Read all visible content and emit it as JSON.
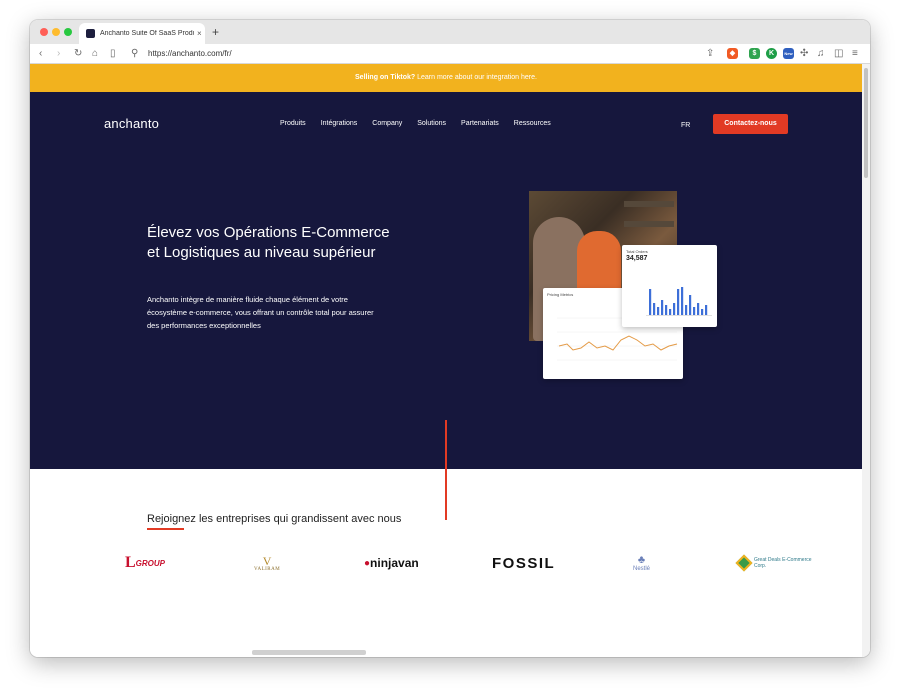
{
  "browser": {
    "tab_title": "Anchanto Suite Of SaaS Produ",
    "tab_close": "×",
    "new_tab": "+",
    "url": "https://anchanto.com/fr/",
    "ext_badge": "New"
  },
  "banner": {
    "bold": "Selling on Tiktok?",
    "text": " Learn more about our integration here."
  },
  "header": {
    "logo": "anchanto",
    "nav": [
      "Produits",
      "Intégrations",
      "Company",
      "Solutions",
      "Partenariats",
      "Ressources"
    ],
    "lang": "FR",
    "cta": "Contactez-nous"
  },
  "hero": {
    "title": "Élevez vos Opérations E-Commerce et Logistiques au niveau supérieur",
    "subtitle": "Anchanto intègre de manière fluide chaque élément de votre écosystème e-commerce, vous offrant un contrôle total pour assurer des performances exceptionnelles"
  },
  "dashboard": {
    "orders_label": "Total Orders",
    "orders_value": "34,587",
    "pricing_label": "Pricing Metrics"
  },
  "clients": {
    "title": "Rejoignez les entreprises qui grandissent avec nous",
    "logos": [
      "GROUP",
      "VALIRAM",
      "ninjavan",
      "FOSSIL",
      "Nestlé",
      "Great Deals E-Commerce Corp."
    ]
  },
  "colors": {
    "banner": "#f2b21e",
    "hero_bg": "#16173d",
    "accent_red": "#e23a24",
    "chart_blue": "#3d6fd8",
    "chart_orange": "#e49a45"
  }
}
